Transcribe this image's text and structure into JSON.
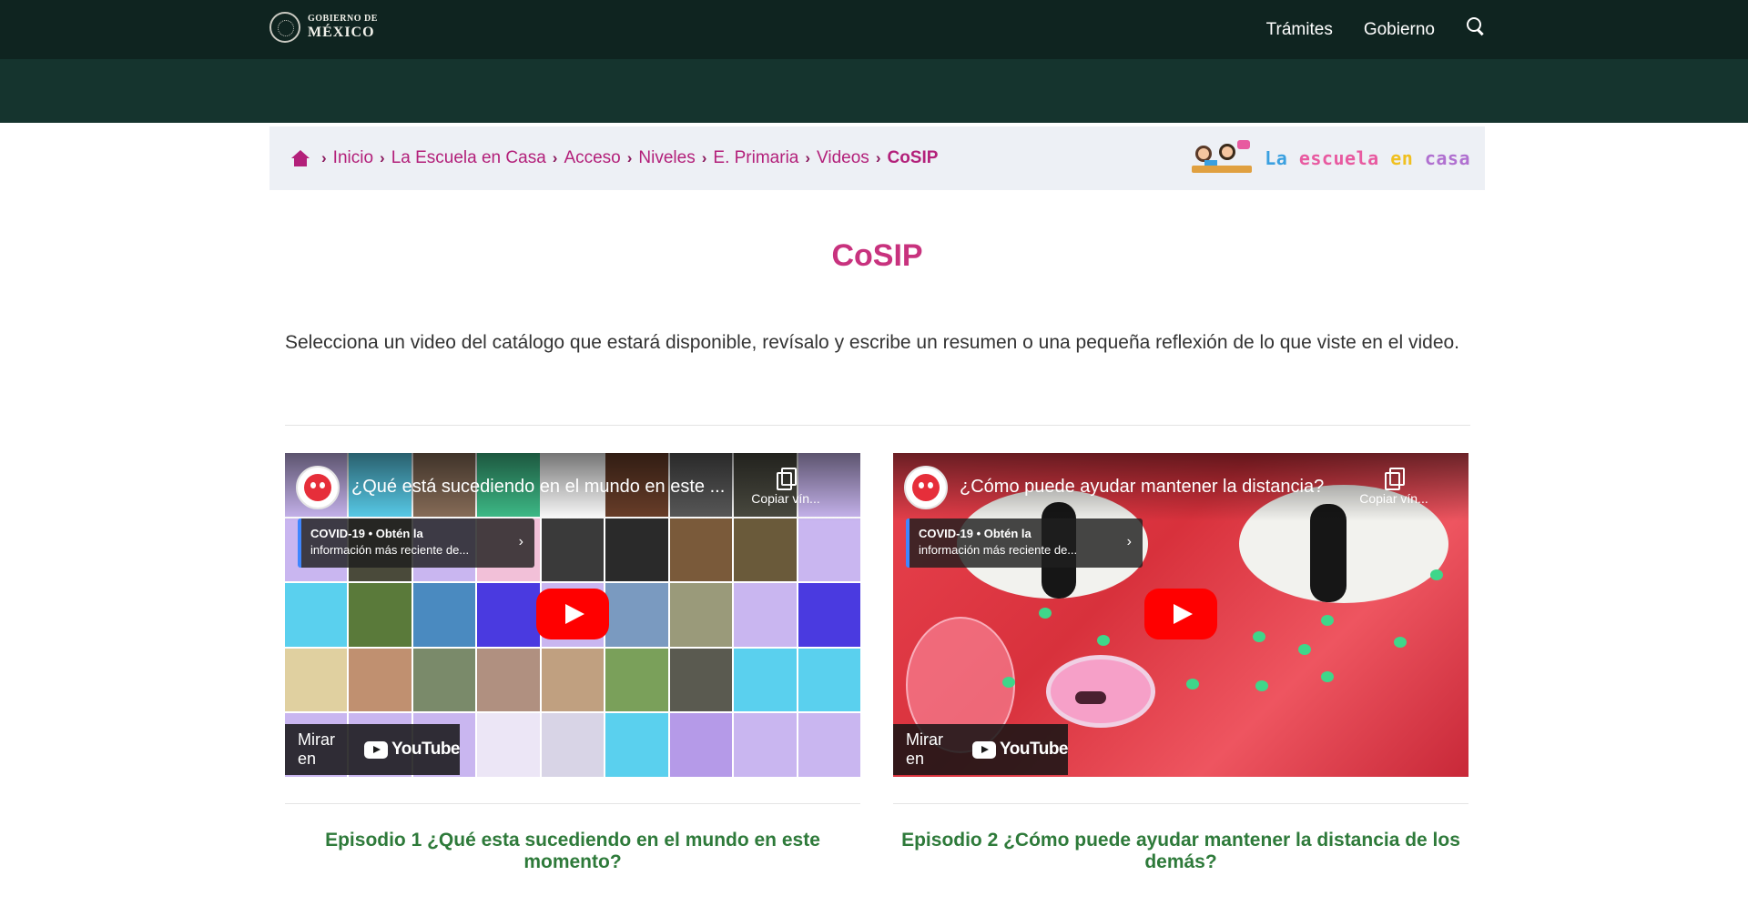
{
  "header": {
    "logo_line1": "GOBIERNO DE",
    "logo_line2": "MÉXICO",
    "nav": [
      "Trámites",
      "Gobierno"
    ],
    "search_icon": "search-icon"
  },
  "breadcrumb": {
    "items": [
      "Inicio",
      "La Escuela en Casa",
      "Acceso",
      "Niveles",
      "E. Primaria",
      "Videos"
    ],
    "current": "CoSIP",
    "brand_words": [
      "La",
      "escuela",
      "en",
      "casa"
    ]
  },
  "page": {
    "title": "CoSIP",
    "intro": "Selecciona un video del catálogo que estará disponible, revísalo y escribe un resumen o una pequeña reflexión de lo que viste en el video."
  },
  "videos": [
    {
      "title": "¿Qué está sucediendo en el mundo en este ...",
      "copy_label": "Copiar vín...",
      "info_bold": "COVID-19 • Obtén la",
      "info_rest": "información más reciente de...",
      "watch_label": "Mirar en",
      "yt_label": "YouTube",
      "episode": "Episodio 1 ¿Qué esta sucediendo en el mundo en este momento?"
    },
    {
      "title": "¿Cómo puede ayudar mantener la distancia?",
      "copy_label": "Copiar vín...",
      "info_bold": "COVID-19 • Obtén la",
      "info_rest": "información más reciente de...",
      "watch_label": "Mirar en",
      "yt_label": "YouTube",
      "episode": "Episodio 2 ¿Cómo puede ayudar mantener la distancia de los demás?"
    }
  ],
  "colors": {
    "nav_bg": "#0f2420",
    "accent": "#c8327e",
    "episode": "#2e7a3a",
    "grid_cells": [
      "#c9b6f0",
      "#5ad0ee",
      "#8a6f5a",
      "#3fbf8a",
      "#ffffff",
      "#6b3f2a",
      "#5a5a5a",
      "#4a4a40",
      "#c9b6f0",
      "#c9b6f0",
      "#4a4a3a",
      "#c9b6f0",
      "#f2c0d8",
      "#3a3a3a",
      "#2a2a2a",
      "#7a5a3a",
      "#6a5a3a",
      "#c9b6f0",
      "#5ad0ee",
      "#5a7a3a",
      "#4a8ac0",
      "#4a3ae0",
      "#c9b6f0",
      "#7a9ac0",
      "#9a9a7a",
      "#c9b6f0",
      "#4a3ae0",
      "#e0d0a0",
      "#c09070",
      "#7a8a6a",
      "#b09080",
      "#c0a080",
      "#7aa05a",
      "#5a5a50",
      "#5ad0ee",
      "#5ad0ee",
      "#c9b6f0",
      "#c9b6f0",
      "#c9b6f0",
      "#ece6f6",
      "#d8d4e6",
      "#5ad0ee",
      "#b59ae8",
      "#c9b6f0",
      "#c9b6f0"
    ]
  }
}
